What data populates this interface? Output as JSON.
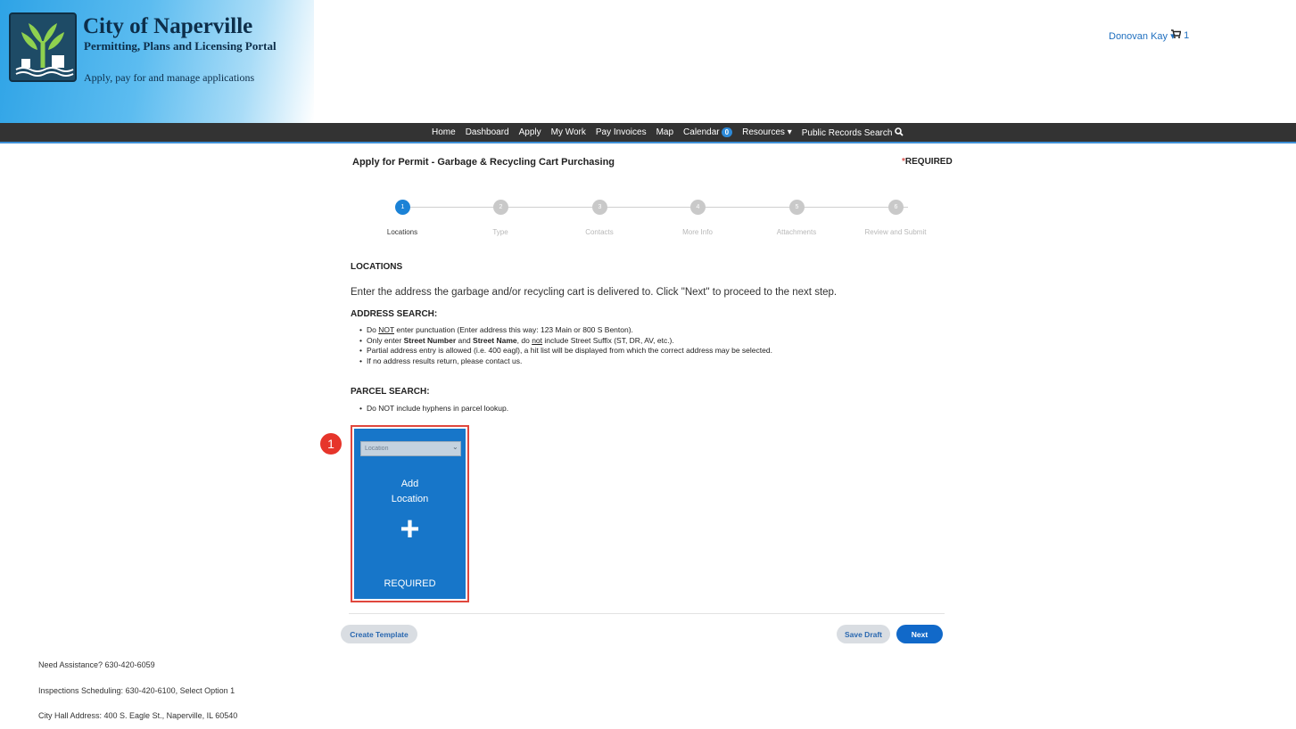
{
  "header": {
    "org_title": "City of Naperville",
    "org_subtitle": "Permitting, Plans and Licensing Portal",
    "tagline": "Apply, pay for and manage applications",
    "user_name": "Donovan Kay",
    "cart_count": "1"
  },
  "nav": {
    "items": [
      "Home",
      "Dashboard",
      "Apply",
      "My Work",
      "Pay Invoices",
      "Map",
      "Calendar",
      "Resources",
      "Public Records Search"
    ],
    "calendar_badge": "0"
  },
  "main": {
    "page_title": "Apply for Permit - Garbage & Recycling Cart Purchasing",
    "required_note": "REQUIRED",
    "steps": [
      {
        "num": "1",
        "label": "Locations"
      },
      {
        "num": "2",
        "label": "Type"
      },
      {
        "num": "3",
        "label": "Contacts"
      },
      {
        "num": "4",
        "label": "More Info"
      },
      {
        "num": "5",
        "label": "Attachments"
      },
      {
        "num": "6",
        "label": "Review and Submit"
      }
    ],
    "current_step": 1,
    "section_title": "LOCATIONS",
    "intro": "Enter the address the garbage and/or recycling cart is delivered to. Click \"Next\" to proceed to the next step.",
    "address_search": {
      "title": "ADDRESS SEARCH:",
      "b1_pre": "Do ",
      "b1_u": "NOT",
      "b1_post": " enter punctuation (Enter address this way: 123 Main or 800 S Benton).",
      "b2_a": "Only enter ",
      "b2_b": "Street Number",
      "b2_c": " and ",
      "b2_d": "Street Name",
      "b2_e": ", do ",
      "b2_f": "not",
      "b2_g": " include Street Suffix (ST, DR, AV, etc.).",
      "b3": "Partial address entry is allowed (i.e. 400 eagl), a hit list will be displayed from which the correct address may be selected.",
      "b4": "If no address results return, please contact us."
    },
    "parcel_search": {
      "title": "PARCEL SEARCH:",
      "b1": "Do NOT include hyphens in parcel lookup."
    },
    "location_card": {
      "select_value": "Location",
      "add_line1": "Add",
      "add_line2": "Location",
      "plus": "+",
      "required": "REQUIRED"
    },
    "callout_number": "1",
    "buttons": {
      "create_template": "Create Template",
      "save_draft": "Save Draft",
      "next": "Next"
    }
  },
  "footer": {
    "assist": "Need Assistance? 630-420-6059",
    "inspections": "Inspections Scheduling: 630-420-6100, Select Option 1",
    "city_hall": "City Hall Address: 400 S. Eagle St., Naperville, IL 60540"
  }
}
